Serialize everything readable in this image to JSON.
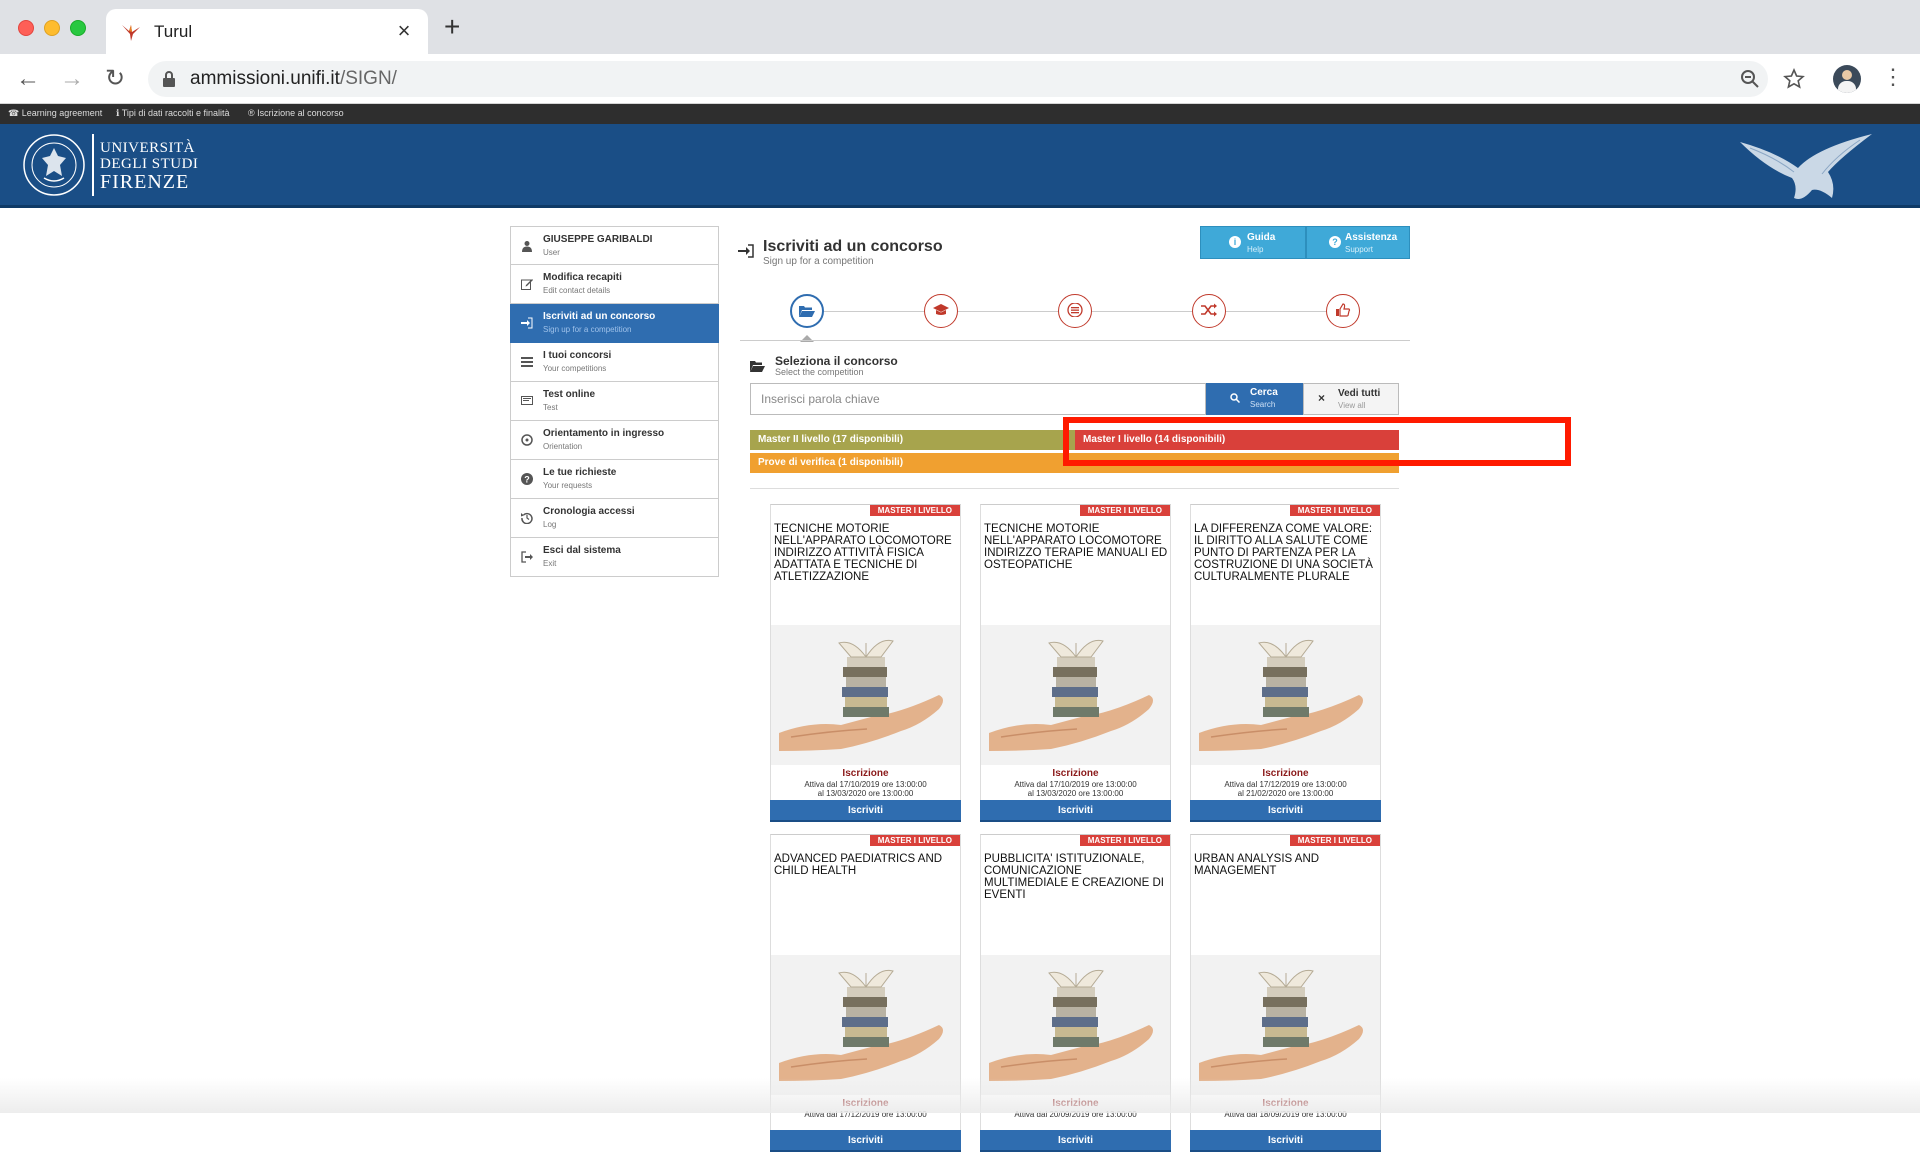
{
  "browser": {
    "tab_title": "Turul",
    "url_host": "ammissioni.unifi.it",
    "url_path": "/SIGN/"
  },
  "topnav": {
    "items": [
      "Learning agreement",
      "Tipi di dati raccolti e finalità",
      "Iscrizione al concorso"
    ]
  },
  "logo": {
    "line1": "UNIVERSITÀ",
    "line2": "DEGLI STUDI",
    "line3": "FIRENZE"
  },
  "sidebar": {
    "items": [
      {
        "label": "GIUSEPPE GARIBALDI",
        "sub": "User",
        "icon": "user-icon"
      },
      {
        "label": "Modifica recapiti",
        "sub": "Edit contact details",
        "icon": "edit-icon"
      },
      {
        "label": "Iscriviti ad un concorso",
        "sub": "Sign up for a competition",
        "icon": "sign-in-icon"
      },
      {
        "label": "I tuoi concorsi",
        "sub": "Your competitions",
        "icon": "list-icon"
      },
      {
        "label": "Test online",
        "sub": "Test",
        "icon": "monitor-icon"
      },
      {
        "label": "Orientamento in ingresso",
        "sub": "Orientation",
        "icon": "compass-icon"
      },
      {
        "label": "Le tue richieste",
        "sub": "Your requests",
        "icon": "question-icon"
      },
      {
        "label": "Cronologia accessi",
        "sub": "Log",
        "icon": "history-icon"
      },
      {
        "label": "Esci dal sistema",
        "sub": "Exit",
        "icon": "exit-icon"
      }
    ]
  },
  "main": {
    "title": "Iscriviti ad un concorso",
    "subtitle": "Sign up for a competition",
    "help": {
      "label": "Guida",
      "sub": "Help"
    },
    "support": {
      "label": "Assistenza",
      "sub": "Support"
    },
    "steps": [
      "folder-open-icon",
      "graduation-cap-icon",
      "list-icon",
      "shuffle-icon",
      "thumbs-up-icon"
    ],
    "select_title": "Seleziona il concorso",
    "select_sub": "Select the competition",
    "search_placeholder": "Inserisci parola chiave",
    "search_btn": {
      "label": "Cerca",
      "sub": "Search"
    },
    "viewall_btn": {
      "label": "Vedi tutti",
      "sub": "View all"
    },
    "categories": [
      {
        "label": "Master II livello (17 disponibili)",
        "color": "#a7a44d"
      },
      {
        "label": "Master I livello (14 disponibili)",
        "color": "#d9403a"
      },
      {
        "label": "Prove di verifica (1 disponibili)",
        "color": "#f0a030"
      }
    ],
    "cards": [
      {
        "badge": "MASTER I LIVELLO",
        "title": "TECNICHE MOTORIE NELL'APPARATO LOCOMOTORE INDIRIZZO ATTIVITÀ FISICA ADATTATA E TECNICHE DI ATLETIZZAZIONE",
        "status": "Iscrizione",
        "dates1": "Attiva dal 17/10/2019 ore 13:00:00",
        "dates2": "al 13/03/2020 ore 13:00:00",
        "button": "Iscriviti"
      },
      {
        "badge": "MASTER I LIVELLO",
        "title": "TECNICHE MOTORIE NELL'APPARATO LOCOMOTORE INDIRIZZO TERAPIE MANUALI ED OSTEOPATICHE",
        "status": "Iscrizione",
        "dates1": "Attiva dal 17/10/2019 ore 13:00:00",
        "dates2": "al 13/03/2020 ore 13:00:00",
        "button": "Iscriviti"
      },
      {
        "badge": "MASTER I LIVELLO",
        "title": "LA DIFFERENZA COME VALORE: IL DIRITTO ALLA SALUTE COME PUNTO DI PARTENZA PER LA COSTRUZIONE DI UNA SOCIETÀ CULTURALMENTE PLURALE",
        "status": "Iscrizione",
        "dates1": "Attiva dal 17/12/2019 ore 13:00:00",
        "dates2": "al 21/02/2020 ore 13:00:00",
        "button": "Iscriviti"
      },
      {
        "badge": "MASTER I LIVELLO",
        "title": "ADVANCED PAEDIATRICS AND CHILD HEALTH",
        "status": "Iscrizione",
        "dates1": "Attiva dal 17/12/2019 ore 13:00:00",
        "dates2": "",
        "button": "Iscriviti"
      },
      {
        "badge": "MASTER I LIVELLO",
        "title": "PUBBLICITA' ISTITUZIONALE, COMUNICAZIONE MULTIMEDIALE E CREAZIONE DI EVENTI",
        "status": "Iscrizione",
        "dates1": "Attiva dal 20/09/2019 ore 13:00:00",
        "dates2": "",
        "button": "Iscriviti"
      },
      {
        "badge": "MASTER I LIVELLO",
        "title": "URBAN ANALYSIS AND MANAGEMENT",
        "status": "Iscrizione",
        "dates1": "Attiva dal 18/09/2019 ore 13:00:00",
        "dates2": "",
        "button": "Iscriviti"
      }
    ]
  }
}
